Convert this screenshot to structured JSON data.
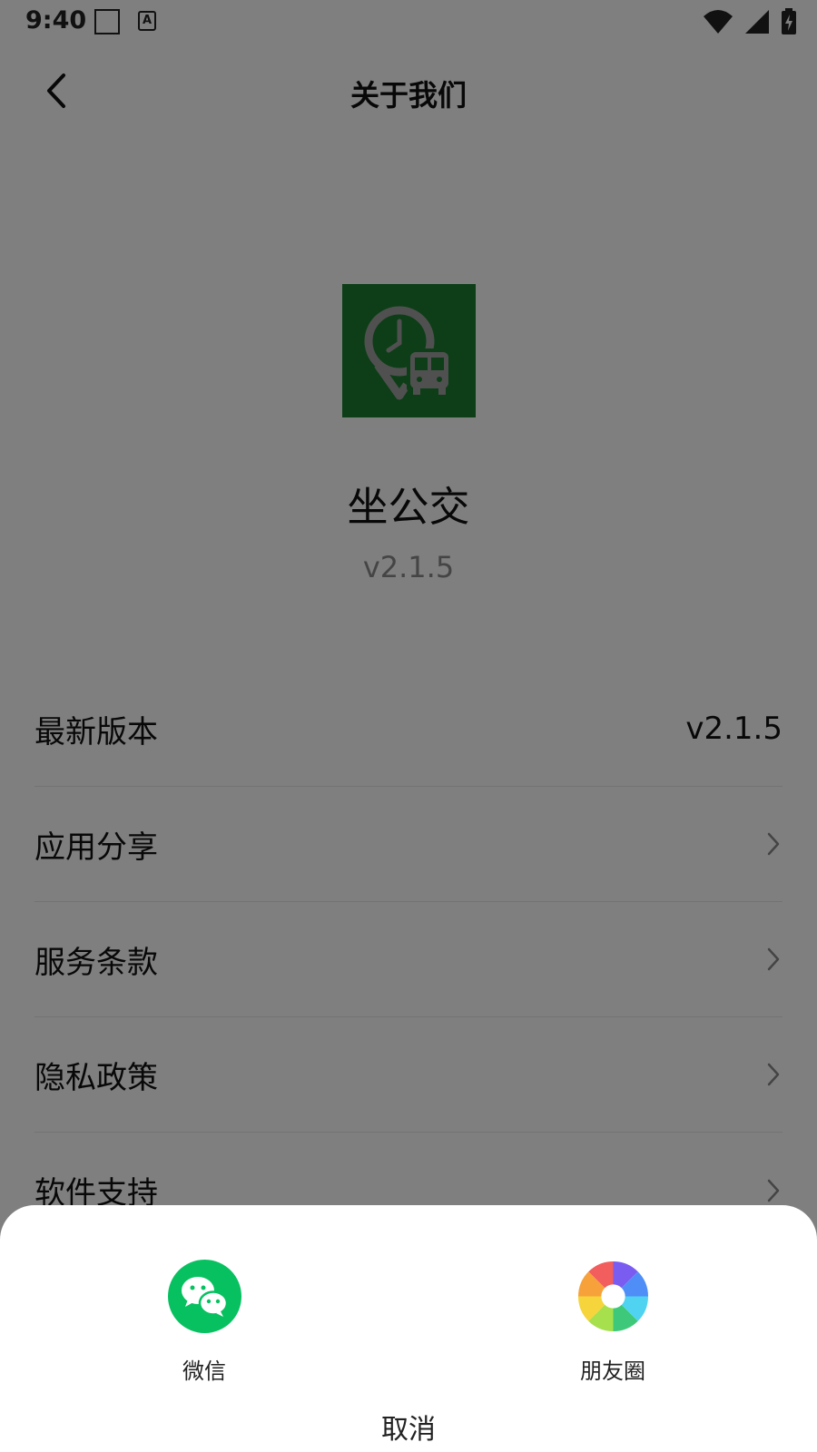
{
  "status_bar": {
    "time": "9:40",
    "input_badge": "A"
  },
  "header": {
    "title": "关于我们"
  },
  "app": {
    "name": "坐公交",
    "version": "v2.1.5"
  },
  "menu": {
    "items": [
      {
        "label": "最新版本",
        "value": "v2.1.5"
      },
      {
        "label": "应用分享"
      },
      {
        "label": "服务条款"
      },
      {
        "label": "隐私政策"
      },
      {
        "label": "软件支持"
      }
    ]
  },
  "share_sheet": {
    "options": [
      {
        "label": "微信",
        "icon": "wechat-icon"
      },
      {
        "label": "朋友圈",
        "icon": "moments-icon"
      }
    ],
    "cancel_label": "取消"
  },
  "colors": {
    "logo_bg": "#1a7c2f",
    "wechat_green": "#07c160",
    "overlay": "#000000"
  }
}
